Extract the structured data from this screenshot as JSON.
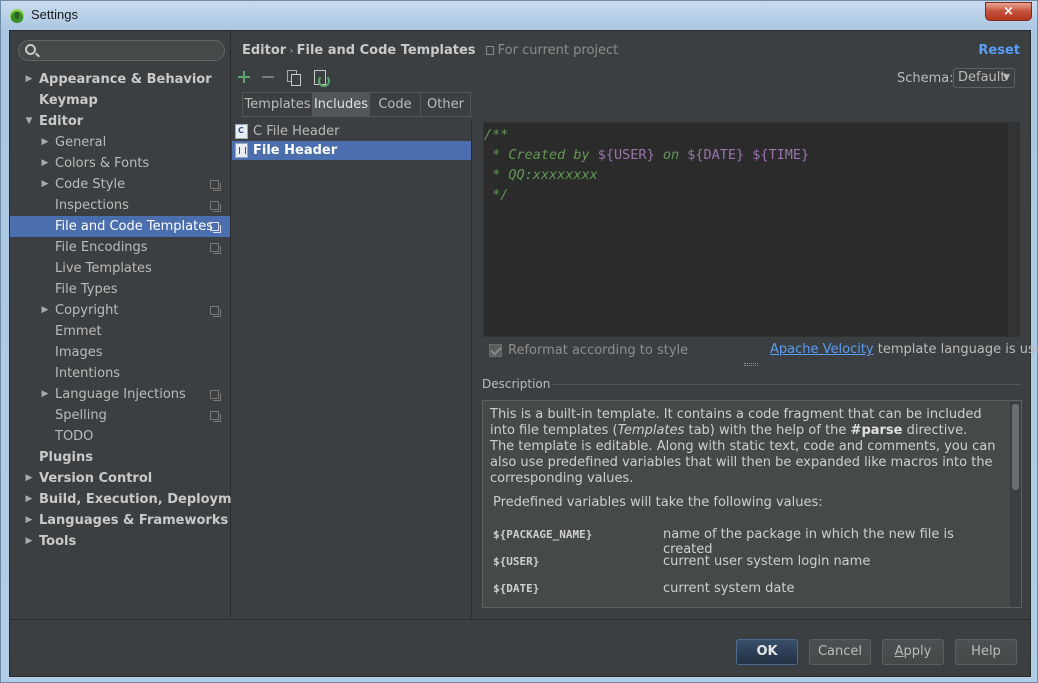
{
  "window": {
    "title": "Settings",
    "close_label": "×"
  },
  "search": {
    "placeholder": ""
  },
  "sidebar": {
    "items": [
      {
        "label": "Appearance & Behavior",
        "bold": true,
        "arrow": "▶",
        "level": 0,
        "selected": false,
        "project": false
      },
      {
        "label": "Keymap",
        "bold": true,
        "arrow": "",
        "level": 0,
        "selected": false,
        "project": false
      },
      {
        "label": "Editor",
        "bold": true,
        "arrow": "▼",
        "level": 0,
        "selected": false,
        "project": false
      },
      {
        "label": "General",
        "bold": false,
        "arrow": "▶",
        "level": 1,
        "selected": false,
        "project": false
      },
      {
        "label": "Colors & Fonts",
        "bold": false,
        "arrow": "▶",
        "level": 1,
        "selected": false,
        "project": false
      },
      {
        "label": "Code Style",
        "bold": false,
        "arrow": "▶",
        "level": 1,
        "selected": false,
        "project": true
      },
      {
        "label": "Inspections",
        "bold": false,
        "arrow": "",
        "level": 1,
        "selected": false,
        "project": true
      },
      {
        "label": "File and Code Templates",
        "bold": false,
        "arrow": "",
        "level": 1,
        "selected": true,
        "project": true
      },
      {
        "label": "File Encodings",
        "bold": false,
        "arrow": "",
        "level": 1,
        "selected": false,
        "project": true
      },
      {
        "label": "Live Templates",
        "bold": false,
        "arrow": "",
        "level": 1,
        "selected": false,
        "project": false
      },
      {
        "label": "File Types",
        "bold": false,
        "arrow": "",
        "level": 1,
        "selected": false,
        "project": false
      },
      {
        "label": "Copyright",
        "bold": false,
        "arrow": "▶",
        "level": 1,
        "selected": false,
        "project": true
      },
      {
        "label": "Emmet",
        "bold": false,
        "arrow": "",
        "level": 1,
        "selected": false,
        "project": false
      },
      {
        "label": "Images",
        "bold": false,
        "arrow": "",
        "level": 1,
        "selected": false,
        "project": false
      },
      {
        "label": "Intentions",
        "bold": false,
        "arrow": "",
        "level": 1,
        "selected": false,
        "project": false
      },
      {
        "label": "Language Injections",
        "bold": false,
        "arrow": "▶",
        "level": 1,
        "selected": false,
        "project": true
      },
      {
        "label": "Spelling",
        "bold": false,
        "arrow": "",
        "level": 1,
        "selected": false,
        "project": true
      },
      {
        "label": "TODO",
        "bold": false,
        "arrow": "",
        "level": 1,
        "selected": false,
        "project": false
      },
      {
        "label": "Plugins",
        "bold": true,
        "arrow": "",
        "level": 0,
        "selected": false,
        "project": false
      },
      {
        "label": "Version Control",
        "bold": true,
        "arrow": "▶",
        "level": 0,
        "selected": false,
        "project": false
      },
      {
        "label": "Build, Execution, Deployment",
        "bold": true,
        "arrow": "▶",
        "level": 0,
        "selected": false,
        "project": false
      },
      {
        "label": "Languages & Frameworks",
        "bold": true,
        "arrow": "▶",
        "level": 0,
        "selected": false,
        "project": false
      },
      {
        "label": "Tools",
        "bold": true,
        "arrow": "▶",
        "level": 0,
        "selected": false,
        "project": false
      }
    ]
  },
  "header": {
    "crumb_root": "Editor",
    "crumb_sep": "›",
    "crumb_page": "File and Code Templates",
    "scope_note": "For current project",
    "reset_label": "Reset"
  },
  "toolbar": {
    "icons": [
      "plus-icon",
      "minus-icon",
      "copy-icon",
      "reset-file-icon"
    ]
  },
  "schema": {
    "label": "Schema:",
    "value": "Default",
    "chevron": "▼"
  },
  "tabs": [
    {
      "label": "Templates",
      "active": false
    },
    {
      "label": "Includes",
      "active": true
    },
    {
      "label": "Code",
      "active": false
    },
    {
      "label": "Other",
      "active": false
    }
  ],
  "files": [
    {
      "label": "C File Header",
      "icon": "c-file-icon",
      "selected": false
    },
    {
      "label": "File Header",
      "icon": "file-header-icon",
      "selected": true
    }
  ],
  "editor": {
    "lines": [
      [
        {
          "t": "/**",
          "k": "cmt"
        }
      ],
      [
        {
          "t": " * Created by ",
          "k": "cmt"
        },
        {
          "t": "${USER}",
          "k": "var"
        },
        {
          "t": " on ",
          "k": "cmt"
        },
        {
          "t": "${DATE}",
          "k": "var"
        },
        {
          "t": " ",
          "k": "cmt"
        },
        {
          "t": "${TIME}",
          "k": "var"
        }
      ],
      [
        {
          "t": " * QQ:xxxxxxxx",
          "k": "cmt"
        }
      ],
      [
        {
          "t": " */",
          "k": "cmt"
        }
      ]
    ]
  },
  "options": {
    "reformat_label": "Reformat according to style",
    "reformat_checked": true,
    "velocity_link": "Apache Velocity",
    "velocity_suffix": " template language is used"
  },
  "description": {
    "title": "Description",
    "p1_a": "This is a built-in template. It contains a code fragment that can be included into file templates (",
    "p1_em": "Templates",
    "p1_b": " tab) with the help of the ",
    "p1_strong": "#parse",
    "p1_c": " directive.",
    "p2": "The template is editable. Along with static text, code and comments, you can also use predefined variables that will then be expanded like macros into the corresponding values.",
    "p3": "Predefined variables will take the following values:",
    "vars": [
      {
        "name": "${PACKAGE_NAME}",
        "desc": "name of the package in which the new file is created"
      },
      {
        "name": "${USER}",
        "desc": "current user system login name"
      },
      {
        "name": "${DATE}",
        "desc": "current system date"
      }
    ]
  },
  "buttons": {
    "ok": "OK",
    "cancel": "Cancel",
    "apply_u": "A",
    "apply_rest": "pply",
    "help": "Help"
  },
  "colors": {
    "accent": "#4b6eaf",
    "link": "#589df6",
    "comment": "#629755",
    "variable": "#9876aa",
    "background": "#3c3f41"
  }
}
